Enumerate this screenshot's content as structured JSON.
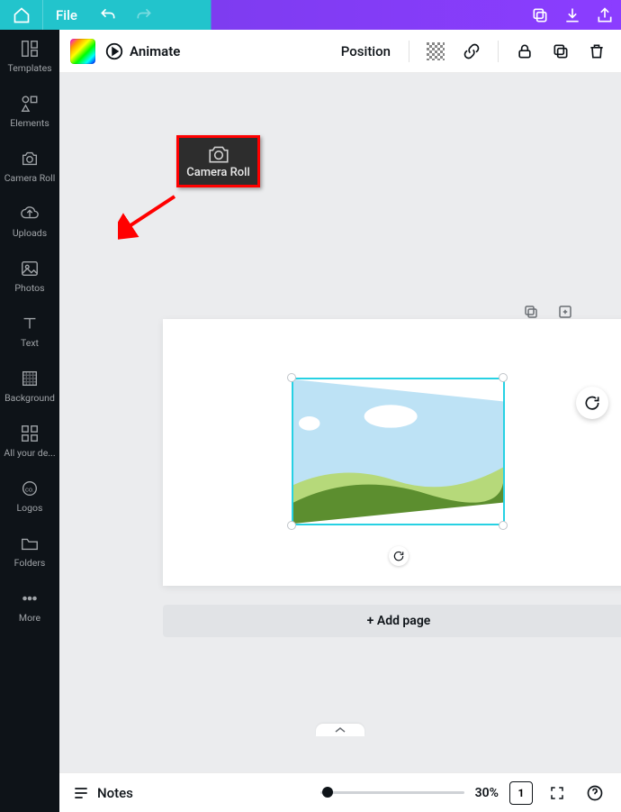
{
  "topbar": {
    "file_label": "File"
  },
  "contextbar": {
    "animate_label": "Animate",
    "position_label": "Position"
  },
  "sidebar": {
    "items": [
      {
        "label": "Templates"
      },
      {
        "label": "Elements"
      },
      {
        "label": "Camera Roll"
      },
      {
        "label": "Uploads"
      },
      {
        "label": "Photos"
      },
      {
        "label": "Text"
      },
      {
        "label": "Background"
      },
      {
        "label": "All your de..."
      },
      {
        "label": "Logos"
      },
      {
        "label": "Folders"
      },
      {
        "label": "More"
      }
    ]
  },
  "callout": {
    "label": "Camera Roll"
  },
  "canvas": {
    "add_page_label": "+ Add page"
  },
  "bottombar": {
    "notes_label": "Notes",
    "zoom_value": "30%",
    "page_count": "1"
  }
}
